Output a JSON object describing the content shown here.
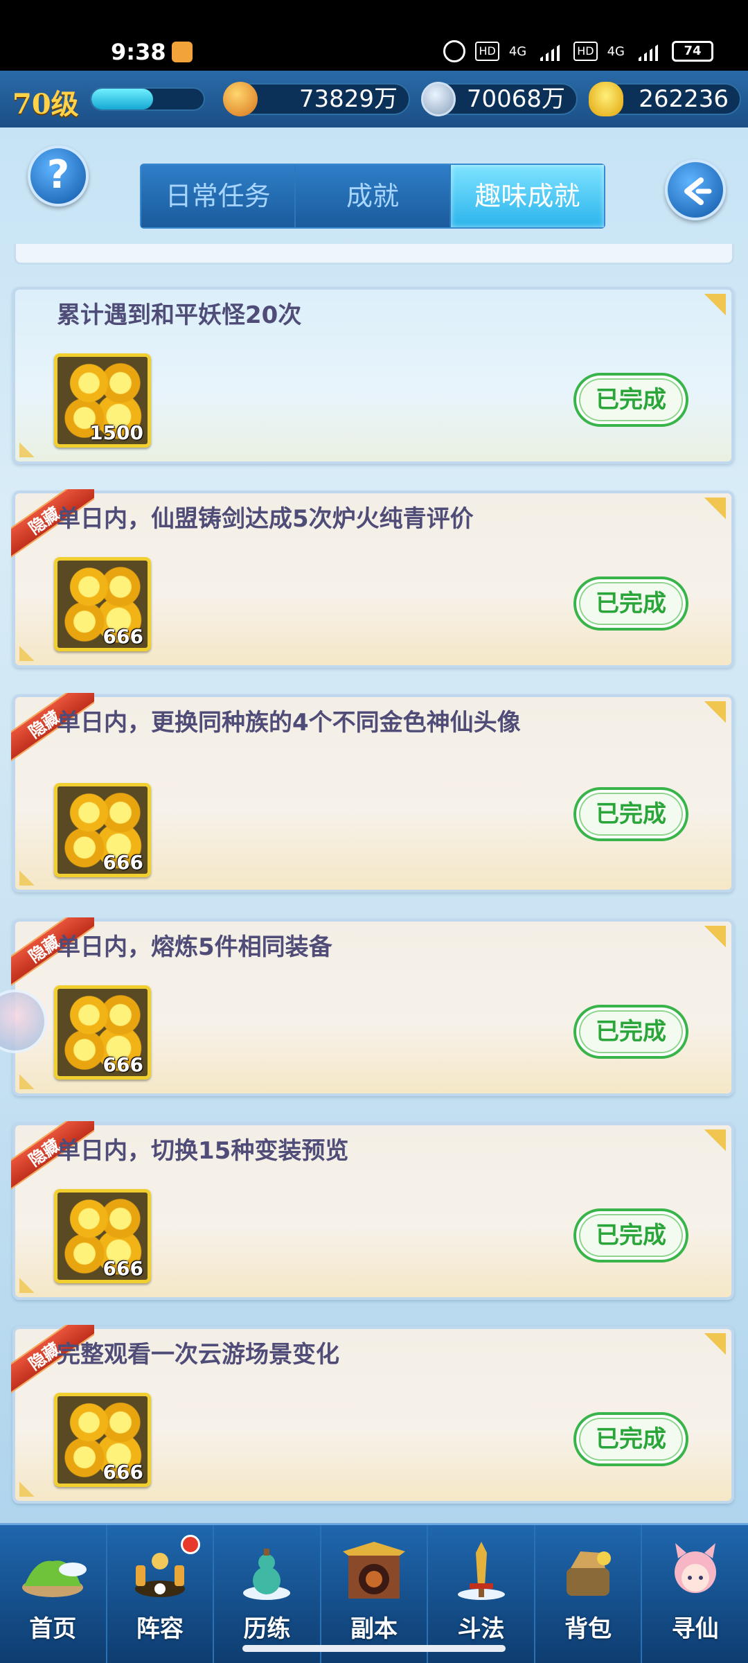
{
  "status_bar": {
    "time": "9:38",
    "hd1": "HD",
    "net1": "4G",
    "hd2": "HD",
    "net2": "4G",
    "battery": "74"
  },
  "player": {
    "level": "70级",
    "xp_fraction": 0.55
  },
  "resources": {
    "combat_power": "73829万",
    "silver": "70068万",
    "gold": "262236"
  },
  "header": {
    "help_label": "?",
    "tabs": [
      {
        "label": "日常任务",
        "active": false
      },
      {
        "label": "成就",
        "active": false
      },
      {
        "label": "趣味成就",
        "active": true
      }
    ]
  },
  "achievements": [
    {
      "title": "累计遇到和平妖怪20次",
      "hidden": false,
      "reward_qty": "1500",
      "status": "已完成"
    },
    {
      "title": "单日内，仙盟铸剑达成5次炉火纯青评价",
      "hidden": true,
      "hidden_label": "隐藏",
      "reward_qty": "666",
      "status": "已完成"
    },
    {
      "title": "单日内，更换同种族的4个不同金色神仙头像",
      "hidden": true,
      "hidden_label": "隐藏",
      "reward_qty": "666",
      "status": "已完成"
    },
    {
      "title": "单日内，熔炼5件相同装备",
      "hidden": true,
      "hidden_label": "隐藏",
      "reward_qty": "666",
      "status": "已完成"
    },
    {
      "title": "单日内，切换15种变装预览",
      "hidden": true,
      "hidden_label": "隐藏",
      "reward_qty": "666",
      "status": "已完成"
    },
    {
      "title": "完整观看一次云游场景变化",
      "hidden": true,
      "hidden_label": "隐藏",
      "reward_qty": "666",
      "status": "已完成"
    }
  ],
  "bottom_nav": [
    {
      "label": "首页",
      "icon": "home-island-icon",
      "badge": false
    },
    {
      "label": "阵容",
      "icon": "lineup-icon",
      "badge": true
    },
    {
      "label": "历练",
      "icon": "training-gourd-icon",
      "badge": false
    },
    {
      "label": "副本",
      "icon": "dungeon-gate-icon",
      "badge": false
    },
    {
      "label": "斗法",
      "icon": "battle-sword-icon",
      "badge": false
    },
    {
      "label": "背包",
      "icon": "bag-icon",
      "badge": false
    },
    {
      "label": "寻仙",
      "icon": "seek-immortal-icon",
      "badge": false
    }
  ],
  "colors": {
    "done_green": "#2aa53a",
    "title_purple": "#4f4c78",
    "hidden_ribbon": "#c0301d",
    "gold_border": "#f1cf2f"
  }
}
